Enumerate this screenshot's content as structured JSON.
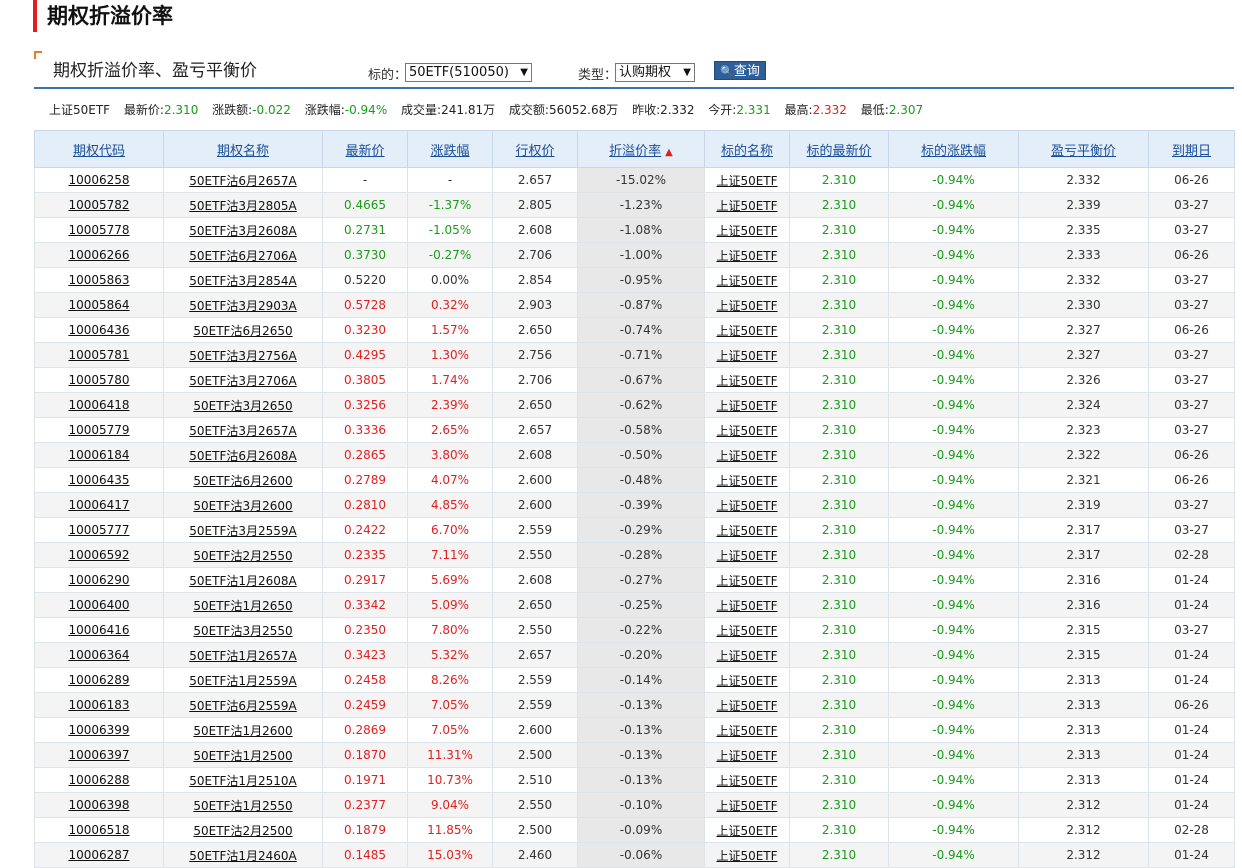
{
  "page": {
    "title": "期权折溢价率"
  },
  "panel": {
    "title": "期权折溢价率、盈亏平衡价"
  },
  "filters": {
    "underlying_label": "标的：",
    "underlying_value": "50ETF(510050)",
    "type_label": "类型：",
    "type_value": "认购期权",
    "query_label": "查询"
  },
  "quote": {
    "name": "上证50ETF",
    "last_label": "最新价:",
    "last": "2.310",
    "chg_label": "涨跌额:",
    "chg": "-0.022",
    "pct_label": "涨跌幅:",
    "pct": "-0.94%",
    "vol_label": "成交量:",
    "vol": "241.81万",
    "amt_label": "成交额:",
    "amt": "56052.68万",
    "prev_label": "昨收:",
    "prev": "2.332",
    "open_label": "今开:",
    "open": "2.331",
    "high_label": "最高:",
    "high": "2.332",
    "low_label": "最低:",
    "low": "2.307"
  },
  "table": {
    "headers": [
      "期权代码",
      "期权名称",
      "最新价",
      "涨跌幅",
      "行权价",
      "折溢价率",
      "标的名称",
      "标的最新价",
      "标的涨跌幅",
      "盈亏平衡价",
      "到期日"
    ],
    "rows": [
      [
        "10006258",
        "50ETF沽6月2657A",
        "-",
        "-",
        "2.657",
        "-15.02%",
        "上证50ETF",
        "2.310",
        "-0.94%",
        "2.332",
        "06-26"
      ],
      [
        "10005782",
        "50ETF沽3月2805A",
        "0.4665",
        "-1.37%",
        "2.805",
        "-1.23%",
        "上证50ETF",
        "2.310",
        "-0.94%",
        "2.339",
        "03-27"
      ],
      [
        "10005778",
        "50ETF沽3月2608A",
        "0.2731",
        "-1.05%",
        "2.608",
        "-1.08%",
        "上证50ETF",
        "2.310",
        "-0.94%",
        "2.335",
        "03-27"
      ],
      [
        "10006266",
        "50ETF沽6月2706A",
        "0.3730",
        "-0.27%",
        "2.706",
        "-1.00%",
        "上证50ETF",
        "2.310",
        "-0.94%",
        "2.333",
        "06-26"
      ],
      [
        "10005863",
        "50ETF沽3月2854A",
        "0.5220",
        "0.00%",
        "2.854",
        "-0.95%",
        "上证50ETF",
        "2.310",
        "-0.94%",
        "2.332",
        "03-27"
      ],
      [
        "10005864",
        "50ETF沽3月2903A",
        "0.5728",
        "0.32%",
        "2.903",
        "-0.87%",
        "上证50ETF",
        "2.310",
        "-0.94%",
        "2.330",
        "03-27"
      ],
      [
        "10006436",
        "50ETF沽6月2650",
        "0.3230",
        "1.57%",
        "2.650",
        "-0.74%",
        "上证50ETF",
        "2.310",
        "-0.94%",
        "2.327",
        "06-26"
      ],
      [
        "10005781",
        "50ETF沽3月2756A",
        "0.4295",
        "1.30%",
        "2.756",
        "-0.71%",
        "上证50ETF",
        "2.310",
        "-0.94%",
        "2.327",
        "03-27"
      ],
      [
        "10005780",
        "50ETF沽3月2706A",
        "0.3805",
        "1.74%",
        "2.706",
        "-0.67%",
        "上证50ETF",
        "2.310",
        "-0.94%",
        "2.326",
        "03-27"
      ],
      [
        "10006418",
        "50ETF沽3月2650",
        "0.3256",
        "2.39%",
        "2.650",
        "-0.62%",
        "上证50ETF",
        "2.310",
        "-0.94%",
        "2.324",
        "03-27"
      ],
      [
        "10005779",
        "50ETF沽3月2657A",
        "0.3336",
        "2.65%",
        "2.657",
        "-0.58%",
        "上证50ETF",
        "2.310",
        "-0.94%",
        "2.323",
        "03-27"
      ],
      [
        "10006184",
        "50ETF沽6月2608A",
        "0.2865",
        "3.80%",
        "2.608",
        "-0.50%",
        "上证50ETF",
        "2.310",
        "-0.94%",
        "2.322",
        "06-26"
      ],
      [
        "10006435",
        "50ETF沽6月2600",
        "0.2789",
        "4.07%",
        "2.600",
        "-0.48%",
        "上证50ETF",
        "2.310",
        "-0.94%",
        "2.321",
        "06-26"
      ],
      [
        "10006417",
        "50ETF沽3月2600",
        "0.2810",
        "4.85%",
        "2.600",
        "-0.39%",
        "上证50ETF",
        "2.310",
        "-0.94%",
        "2.319",
        "03-27"
      ],
      [
        "10005777",
        "50ETF沽3月2559A",
        "0.2422",
        "6.70%",
        "2.559",
        "-0.29%",
        "上证50ETF",
        "2.310",
        "-0.94%",
        "2.317",
        "03-27"
      ],
      [
        "10006592",
        "50ETF沽2月2550",
        "0.2335",
        "7.11%",
        "2.550",
        "-0.28%",
        "上证50ETF",
        "2.310",
        "-0.94%",
        "2.317",
        "02-28"
      ],
      [
        "10006290",
        "50ETF沽1月2608A",
        "0.2917",
        "5.69%",
        "2.608",
        "-0.27%",
        "上证50ETF",
        "2.310",
        "-0.94%",
        "2.316",
        "01-24"
      ],
      [
        "10006400",
        "50ETF沽1月2650",
        "0.3342",
        "5.09%",
        "2.650",
        "-0.25%",
        "上证50ETF",
        "2.310",
        "-0.94%",
        "2.316",
        "01-24"
      ],
      [
        "10006416",
        "50ETF沽3月2550",
        "0.2350",
        "7.80%",
        "2.550",
        "-0.22%",
        "上证50ETF",
        "2.310",
        "-0.94%",
        "2.315",
        "03-27"
      ],
      [
        "10006364",
        "50ETF沽1月2657A",
        "0.3423",
        "5.32%",
        "2.657",
        "-0.20%",
        "上证50ETF",
        "2.310",
        "-0.94%",
        "2.315",
        "01-24"
      ],
      [
        "10006289",
        "50ETF沽1月2559A",
        "0.2458",
        "8.26%",
        "2.559",
        "-0.14%",
        "上证50ETF",
        "2.310",
        "-0.94%",
        "2.313",
        "01-24"
      ],
      [
        "10006183",
        "50ETF沽6月2559A",
        "0.2459",
        "7.05%",
        "2.559",
        "-0.13%",
        "上证50ETF",
        "2.310",
        "-0.94%",
        "2.313",
        "06-26"
      ],
      [
        "10006399",
        "50ETF沽1月2600",
        "0.2869",
        "7.05%",
        "2.600",
        "-0.13%",
        "上证50ETF",
        "2.310",
        "-0.94%",
        "2.313",
        "01-24"
      ],
      [
        "10006397",
        "50ETF沽1月2500",
        "0.1870",
        "11.31%",
        "2.500",
        "-0.13%",
        "上证50ETF",
        "2.310",
        "-0.94%",
        "2.313",
        "01-24"
      ],
      [
        "10006288",
        "50ETF沽1月2510A",
        "0.1971",
        "10.73%",
        "2.510",
        "-0.13%",
        "上证50ETF",
        "2.310",
        "-0.94%",
        "2.313",
        "01-24"
      ],
      [
        "10006398",
        "50ETF沽1月2550",
        "0.2377",
        "9.04%",
        "2.550",
        "-0.10%",
        "上证50ETF",
        "2.310",
        "-0.94%",
        "2.312",
        "01-24"
      ],
      [
        "10006518",
        "50ETF沽2月2500",
        "0.1879",
        "11.85%",
        "2.500",
        "-0.09%",
        "上证50ETF",
        "2.310",
        "-0.94%",
        "2.312",
        "02-28"
      ],
      [
        "10006287",
        "50ETF沽1月2460A",
        "0.1485",
        "15.03%",
        "2.460",
        "-0.06%",
        "上证50ETF",
        "2.310",
        "-0.94%",
        "2.312",
        "01-24"
      ]
    ]
  },
  "colors": {
    "up": "#e02020",
    "down": "#1a9b1a",
    "header_bg": "#e3eef9",
    "accent": "#3c73b5"
  }
}
